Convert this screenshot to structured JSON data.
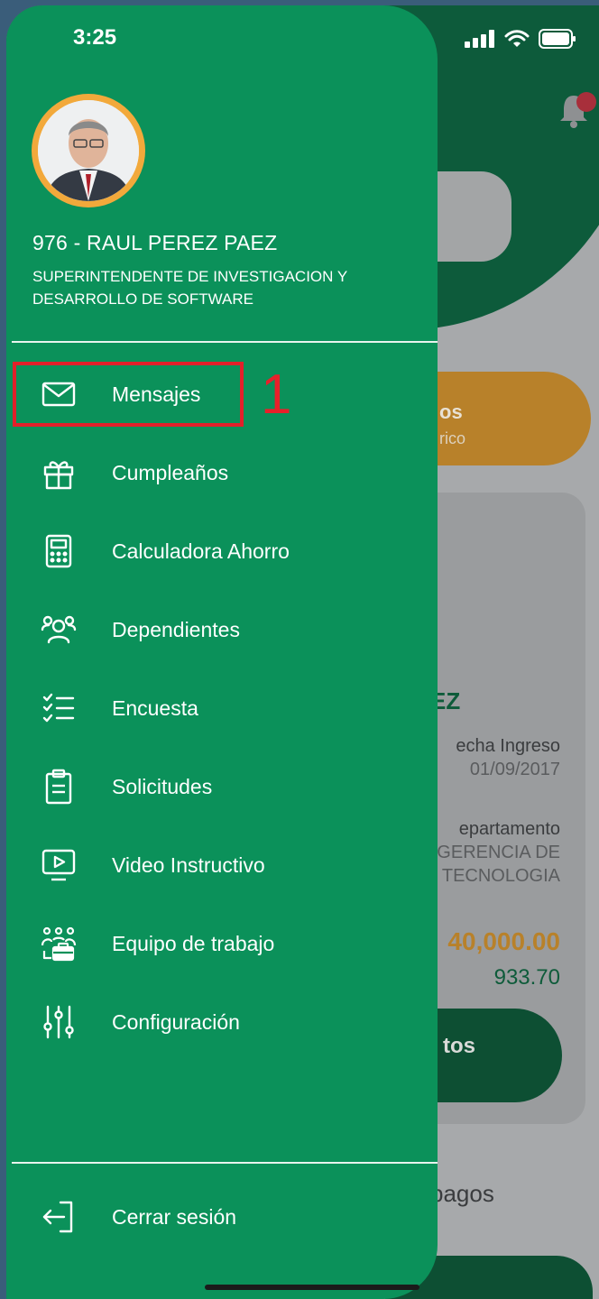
{
  "status_bar": {
    "time": "3:25"
  },
  "user": {
    "name": "976 - RAUL PEREZ PAEZ",
    "title": "SUPERINTENDENTE DE INVESTIGACION Y DESARROLLO DE SOFTWARE"
  },
  "menu": [
    {
      "label": "Mensajes",
      "icon": "mail-icon"
    },
    {
      "label": "Cumpleaños",
      "icon": "gift-icon"
    },
    {
      "label": "Calculadora Ahorro",
      "icon": "calculator-icon"
    },
    {
      "label": "Dependientes",
      "icon": "people-icon"
    },
    {
      "label": "Encuesta",
      "icon": "checklist-icon"
    },
    {
      "label": "Solicitudes",
      "icon": "clipboard-icon"
    },
    {
      "label": "Video Instructivo",
      "icon": "video-icon"
    },
    {
      "label": "Equipo de trabajo",
      "icon": "team-icon"
    },
    {
      "label": "Configuración",
      "icon": "sliders-icon"
    }
  ],
  "logout": {
    "label": "Cerrar sesión",
    "icon": "logout-icon"
  },
  "annotation": {
    "number": "1"
  },
  "background": {
    "orange_title": "os",
    "orange_sub": "rico",
    "name_partial": "EZ",
    "fecha_label": "echa Ingreso",
    "fecha_value": "01/09/2017",
    "depto_label": "epartamento",
    "depto_value_1": "GERENCIA DE",
    "depto_value_2": "TECNOLOGIA",
    "amount_1": "40,000.00",
    "amount_2": "933.70",
    "button_partial": "tos",
    "section_partial": "pagos"
  },
  "colors": {
    "drawer": "#0b915a",
    "highlight": "#e2202a",
    "accent_orange": "#b8812a"
  }
}
